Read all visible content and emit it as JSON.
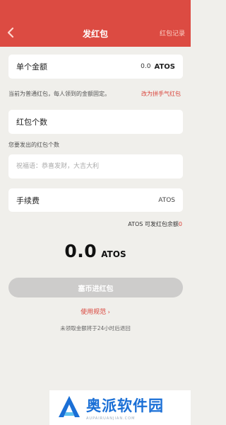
{
  "header": {
    "title": "发红包",
    "right_link": "红包记录"
  },
  "amount_row": {
    "label": "单个金额",
    "value": "0.0",
    "unit": "ATOS"
  },
  "mode_note": {
    "text": "当前为普通红包，每人领到的金额固定。",
    "switch_link": "改为拼手气红包"
  },
  "count_row": {
    "label": "红包个数"
  },
  "count_hint": "您要发出的红包个数",
  "greeting": {
    "placeholder": "祝福语：恭喜发财，大吉大利"
  },
  "fee_row": {
    "label": "手续费",
    "unit": "ATOS"
  },
  "balance": {
    "text": "ATOS 可发红包余额",
    "value": "0"
  },
  "total": {
    "value": "0.0",
    "unit": "ATOS"
  },
  "submit_label": "塞币进红包",
  "rules_link": "使用规范",
  "refund_note": "未领取金额将于24小时后退回",
  "watermark": {
    "cn": "奥派软件园",
    "en": "AUPAIRUANJIAN.COM"
  },
  "colors": {
    "header": "#dc4b42",
    "accent": "#d9443b",
    "background": "#f0efeb",
    "button_disabled": "#cdcccb"
  }
}
